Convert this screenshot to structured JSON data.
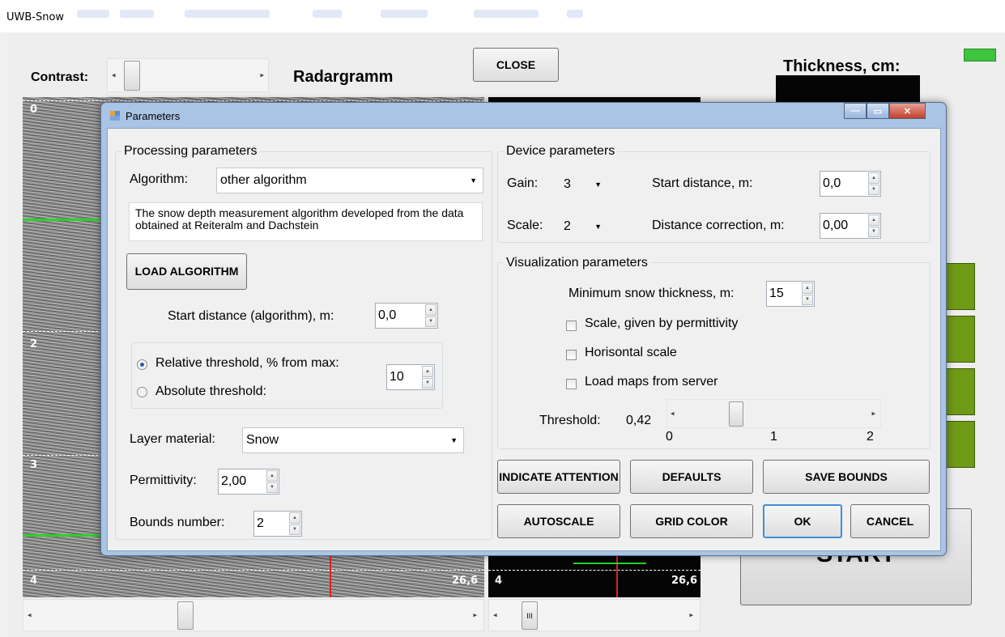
{
  "window": {
    "title": "UWB-Snow"
  },
  "main": {
    "contrast_label": "Contrast:",
    "radargram_title": "Radargramm",
    "close_label": "CLOSE",
    "thickness_label": "Thickness, cm:",
    "start_label": "START",
    "depth_labels": [
      "0",
      "2",
      "3",
      "4"
    ],
    "distance_value": "26,6",
    "scroll_glyph": "III"
  },
  "dialog": {
    "title": "Parameters",
    "processing": {
      "title": "Processing parameters",
      "algorithm_label": "Algorithm:",
      "algorithm_value": "other algorithm",
      "description": "The snow depth measurement algorithm developed from the data obtained at Reiteralm and Dachstein",
      "load_algorithm": "LOAD ALGORITHM",
      "start_distance_label": "Start distance (algorithm), m:",
      "start_distance_value": "0,0",
      "relative_threshold_label": "Relative threshold, % from max:",
      "absolute_threshold_label": "Absolute threshold:",
      "threshold_value": "10",
      "layer_material_label": "Layer material:",
      "layer_material_value": "Snow",
      "permittivity_label": "Permittivity:",
      "permittivity_value": "2,00",
      "bounds_number_label": "Bounds number:",
      "bounds_number_value": "2"
    },
    "device": {
      "title": "Device parameters",
      "gain_label": "Gain:",
      "gain_value": "3",
      "scale_label": "Scale:",
      "scale_value": "2",
      "start_distance_label": "Start distance, m:",
      "start_distance_value": "0,0",
      "distance_correction_label": "Distance correction, m:",
      "distance_correction_value": "0,00"
    },
    "visualization": {
      "title": "Visualization parameters",
      "min_snow_label": "Minimum snow thickness, m:",
      "min_snow_value": "15",
      "scale_permittivity_label": "Scale, given by permittivity",
      "horizontal_scale_label": "Horisontal scale",
      "load_maps_label": "Load maps from server",
      "threshold_label": "Threshold:",
      "threshold_value": "0,42",
      "threshold_ticks": [
        "0",
        "1",
        "2"
      ],
      "threshold_fraction": 0.21
    },
    "buttons": {
      "indicate_attention": "INDICATE ATTENTION",
      "defaults": "DEFAULTS",
      "save_bounds": "SAVE BOUNDS",
      "autoscale": "AUTOSCALE",
      "grid_color": "GRID COLOR",
      "ok": "OK",
      "cancel": "CANCEL"
    }
  },
  "colors": {
    "status_led": "#3fc43f",
    "trace_green": "#2bd12b",
    "marker_red": "#e02020",
    "green_buttons": "#6f9a16"
  }
}
